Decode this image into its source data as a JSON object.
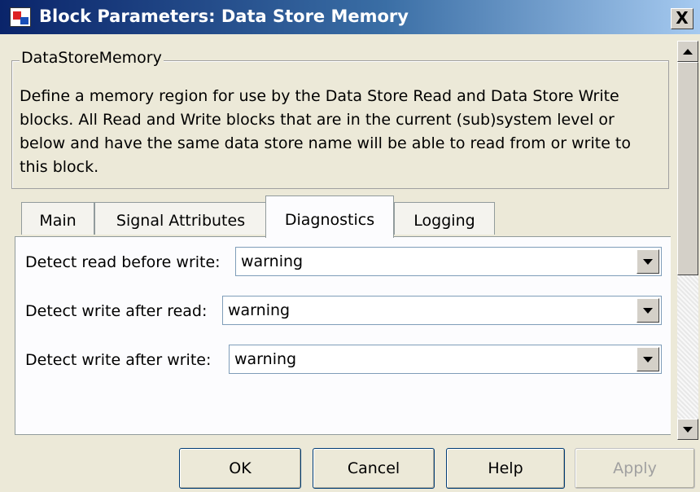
{
  "window": {
    "title": "Block Parameters: Data Store Memory",
    "close_label": "X"
  },
  "group": {
    "legend": "DataStoreMemory",
    "description": "Define a memory region for use by the Data Store Read and Data Store Write blocks. All Read and Write blocks that are in the current (sub)system level or below and have the same data store name will be able to read from or write to this block."
  },
  "tabs": [
    {
      "label": "Main",
      "active": false
    },
    {
      "label": "Signal Attributes",
      "active": false
    },
    {
      "label": "Diagnostics",
      "active": true
    },
    {
      "label": "Logging",
      "active": false
    }
  ],
  "diagnostics": [
    {
      "label": "Detect read before write:",
      "value": "warning"
    },
    {
      "label": "Detect write after read:",
      "value": "warning"
    },
    {
      "label": "Detect write after write:",
      "value": "warning"
    }
  ],
  "buttons": {
    "ok": "OK",
    "cancel": "Cancel",
    "help": "Help",
    "apply": "Apply"
  },
  "colors": {
    "title_bar": "#0a246a",
    "dialog_bg": "#ece9d8"
  }
}
